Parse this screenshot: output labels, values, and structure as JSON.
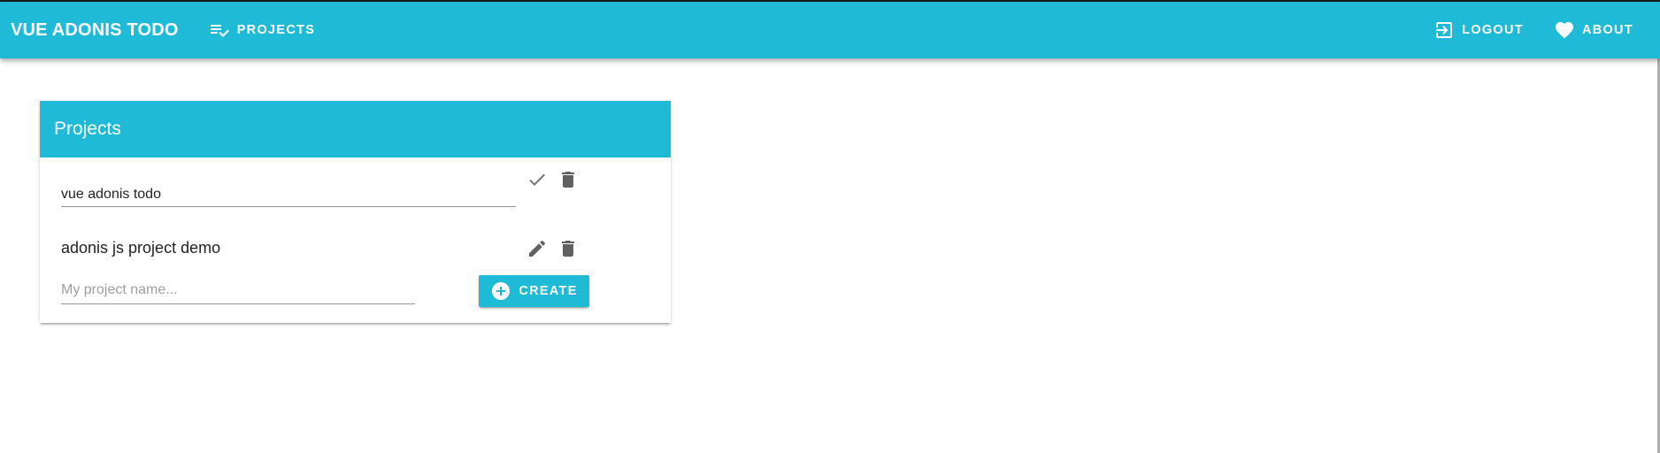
{
  "toolbar": {
    "title": "VUE ADONIS TODO",
    "projects_label": "PROJECTS",
    "logout_label": "LOGOUT",
    "about_label": "ABOUT",
    "color": "#1FBAD6"
  },
  "icons": {
    "projects": "playlist-check-icon",
    "logout": "exit-to-app-icon",
    "about": "heart-icon",
    "save": "check-icon",
    "edit": "pencil-icon",
    "delete": "trash-icon",
    "create": "plus-circle-icon"
  },
  "projects_card": {
    "title": "Projects",
    "projects": [
      {
        "name": "vue adonis todo",
        "editing": true
      },
      {
        "name": "adonis js project demo",
        "editing": false
      }
    ],
    "new_project": {
      "placeholder": "My project name...",
      "value": ""
    },
    "create_label": "CREATE"
  }
}
